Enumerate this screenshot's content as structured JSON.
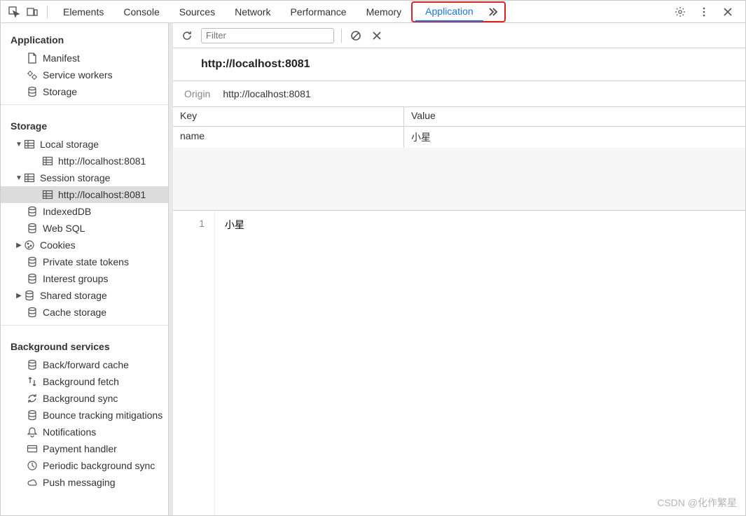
{
  "tabs": {
    "items": [
      "Elements",
      "Console",
      "Sources",
      "Network",
      "Performance",
      "Memory",
      "Application"
    ],
    "active": "Application"
  },
  "sidebar": {
    "application": {
      "header": "Application",
      "items": [
        "Manifest",
        "Service workers",
        "Storage"
      ]
    },
    "storage": {
      "header": "Storage",
      "local": {
        "label": "Local storage",
        "origins": [
          "http://localhost:8081"
        ]
      },
      "session": {
        "label": "Session storage",
        "origins": [
          "http://localhost:8081"
        ]
      },
      "items": [
        "IndexedDB",
        "Web SQL",
        "Cookies",
        "Private state tokens",
        "Interest groups",
        "Shared storage",
        "Cache storage"
      ]
    },
    "background": {
      "header": "Background services",
      "items": [
        "Back/forward cache",
        "Background fetch",
        "Background sync",
        "Bounce tracking mitigations",
        "Notifications",
        "Payment handler",
        "Periodic background sync",
        "Push messaging"
      ]
    }
  },
  "toolbar": {
    "filter_placeholder": "Filter"
  },
  "detail": {
    "title": "http://localhost:8081",
    "origin_label": "Origin",
    "origin_value": "http://localhost:8081"
  },
  "table": {
    "headers": {
      "key": "Key",
      "value": "Value"
    },
    "rows": [
      {
        "key": "name",
        "value": "小星"
      }
    ]
  },
  "preview": {
    "line": "1",
    "value": "小星"
  },
  "watermark": "CSDN @化作繁星"
}
